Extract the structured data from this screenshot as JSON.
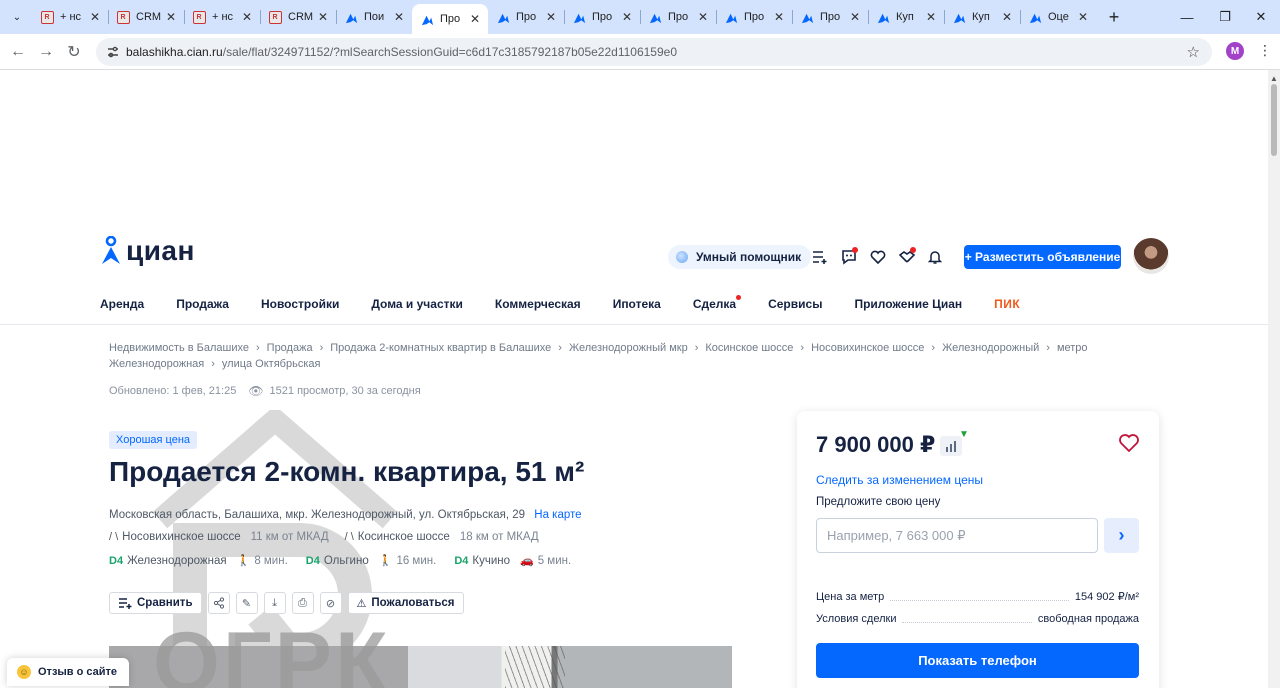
{
  "browser": {
    "tabs": [
      {
        "label": "+ нс",
        "favicon": "crm-icon",
        "active": false
      },
      {
        "label": "CRM",
        "favicon": "crm-icon",
        "active": false
      },
      {
        "label": "+ нс",
        "favicon": "crm-icon",
        "active": false
      },
      {
        "label": "CRM",
        "favicon": "crm-icon",
        "active": false
      },
      {
        "label": "Пои",
        "favicon": "cian-icon",
        "active": false
      },
      {
        "label": "Про",
        "favicon": "cian-icon",
        "active": true
      },
      {
        "label": "Про",
        "favicon": "cian-icon",
        "active": false
      },
      {
        "label": "Про",
        "favicon": "cian-icon",
        "active": false
      },
      {
        "label": "Про",
        "favicon": "cian-icon",
        "active": false
      },
      {
        "label": "Про",
        "favicon": "cian-icon",
        "active": false
      },
      {
        "label": "Про",
        "favicon": "cian-icon",
        "active": false
      },
      {
        "label": "Куп",
        "favicon": "cian-icon",
        "active": false
      },
      {
        "label": "Куп",
        "favicon": "cian-icon",
        "active": false
      },
      {
        "label": "Оце",
        "favicon": "cian-icon",
        "active": false
      }
    ],
    "new_tab": "+",
    "url_host": "balashikha.cian.ru",
    "url_path": "/sale/flat/324971152/?mlSearchSessionGuid=c6d17c3185792187b05e22d1106159e0",
    "profile_initial": "M"
  },
  "header": {
    "logo_text": "циан",
    "assistant_label": "Умный помощник",
    "post_button": "+ Разместить объявление"
  },
  "nav": {
    "items": [
      "Аренда",
      "Продажа",
      "Новостройки",
      "Дома и участки",
      "Коммерческая",
      "Ипотека",
      "Сделка",
      "Сервисы",
      "Приложение Циан"
    ],
    "pik": "ПИК"
  },
  "breadcrumbs": [
    "Недвижимость в Балашихе",
    "Продажа",
    "Продажа 2-комнатных квартир в Балашихе",
    "Железнодорожный мкр",
    "Косинское шоссе",
    "Носовихинское шоссе",
    "Железнодорожный",
    "метро Железнодорожная",
    "улица Октябрьская"
  ],
  "meta": {
    "updated": "Обновлено: 1 фев, 21:25",
    "views": "1521 просмотр, 30 за сегодня"
  },
  "listing": {
    "badge": "Хорошая цена",
    "title": "Продается 2-комн. квартира, 51 м²",
    "address": "Московская область, Балашиха, мкр. Железнодорожный, ул. Октябрьская, 29",
    "map_link": "На карте",
    "highways": [
      {
        "name": "Носовихинское шоссе",
        "distance": "11 км от МКАД"
      },
      {
        "name": "Косинское шоссе",
        "distance": "18 км от МКАД"
      }
    ],
    "stations": [
      {
        "line": "D4",
        "name": "Железнодорожная",
        "time": "8 мин.",
        "mode": "walk"
      },
      {
        "line": "D4",
        "name": "Ольгино",
        "time": "16 мин.",
        "mode": "walk"
      },
      {
        "line": "D4",
        "name": "Кучино",
        "time": "5 мин.",
        "mode": "car"
      }
    ],
    "compare_label": "Сравнить",
    "report_label": "Пожаловаться",
    "watermark_text": "ОГРК"
  },
  "price_card": {
    "price": "7 900 000 ₽",
    "follow_link": "Следить за изменением цены",
    "offer_label": "Предложите свою цену",
    "offer_placeholder": "Например, 7 663 000 ₽",
    "per_meter_label": "Цена за метр",
    "per_meter_value": "154 902 ₽/м²",
    "terms_label": "Условия сделки",
    "terms_value": "свободная продажа",
    "phone_button": "Показать телефон"
  },
  "feedback": {
    "label": "Отзыв о сайте"
  },
  "colors": {
    "accent": "#0468ff",
    "brand_dark": "#152242",
    "green": "#1aa36b",
    "pik": "#f05a1a"
  }
}
